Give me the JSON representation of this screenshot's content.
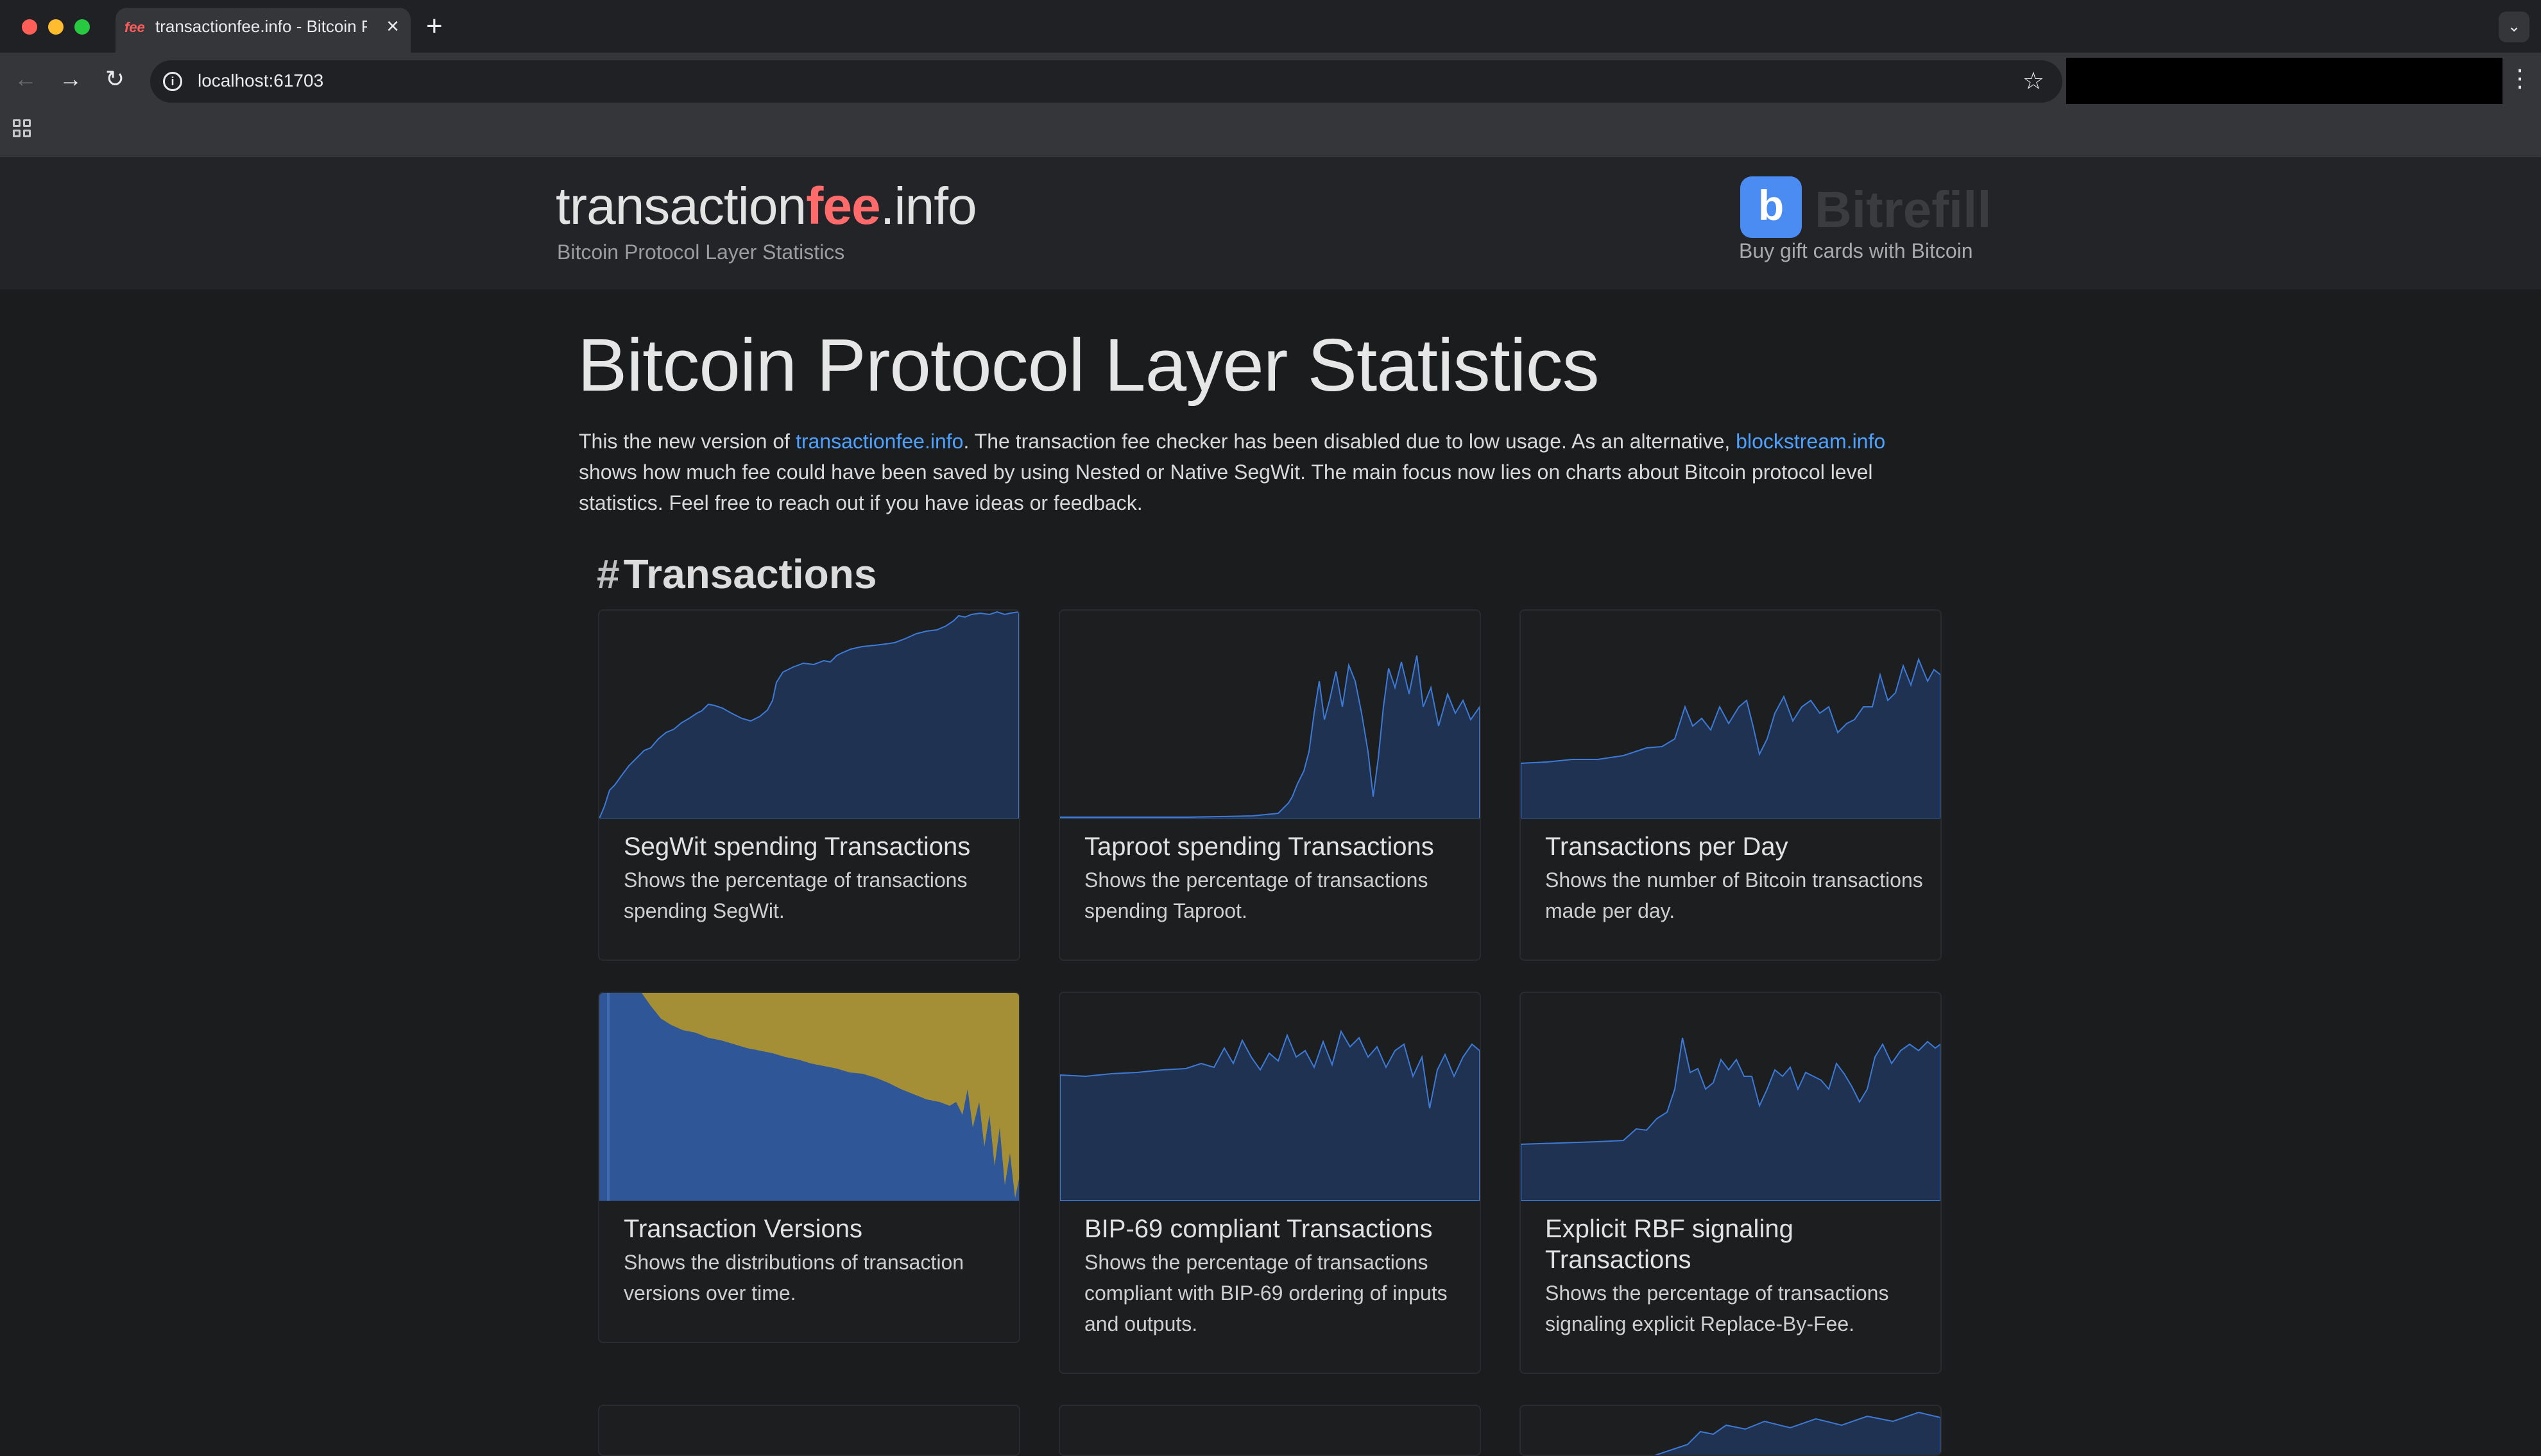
{
  "browser": {
    "tab_title": "transactionfee.info - Bitcoin P",
    "tab_favicon": "fee",
    "url": "localhost:61703"
  },
  "site": {
    "brand_prefix": "transaction",
    "brand_fee": "fee",
    "brand_suffix": ".info",
    "subtitle": "Bitcoin Protocol Layer Statistics",
    "sponsor_name": "Bitrefill",
    "sponsor_logo": "b",
    "sponsor_tagline": "Buy gift cards with Bitcoin"
  },
  "main": {
    "title": "Bitcoin Protocol Layer Statistics",
    "intro": {
      "p1": "This the new version of ",
      "link1": "transactionfee.info",
      "p2": ". The transaction fee checker has been disabled due to low usage. As an alternative, ",
      "link2": "blockstream.info",
      "p3": " shows how much fee could have been saved by using Nested or Native SegWit. The main focus now lies on charts about Bitcoin protocol level statistics. Feel free to reach out if you have ideas or feedback."
    },
    "section_hash": "#",
    "section_title": "Transactions",
    "cards": [
      {
        "title": "SegWit spending Transactions",
        "description": "Shows the percentage of transactions spending SegWit."
      },
      {
        "title": "Taproot spending Transactions",
        "description": "Shows the percentage of transactions spending Taproot."
      },
      {
        "title": "Transactions per Day",
        "description": "Shows the number of Bitcoin transactions made per day."
      },
      {
        "title": "Transaction Versions",
        "description": "Shows the distributions of transaction versions over time."
      },
      {
        "title": "BIP-69 compliant Transactions",
        "description": "Shows the percentage of transactions compliant with BIP-69 ordering of inputs and outputs."
      },
      {
        "title": "Explicit RBF signaling Transactions",
        "description": "Shows the percentage of transactions signaling explicit Replace-By-Fee."
      }
    ]
  },
  "colors": {
    "accent_fee": "#ff6b6b",
    "link": "#4ea1ff",
    "chart_fill": "#1f3252",
    "chart_line": "#3d7ad6",
    "versions_blue": "#2f5797",
    "versions_gold": "#a48f37"
  }
}
